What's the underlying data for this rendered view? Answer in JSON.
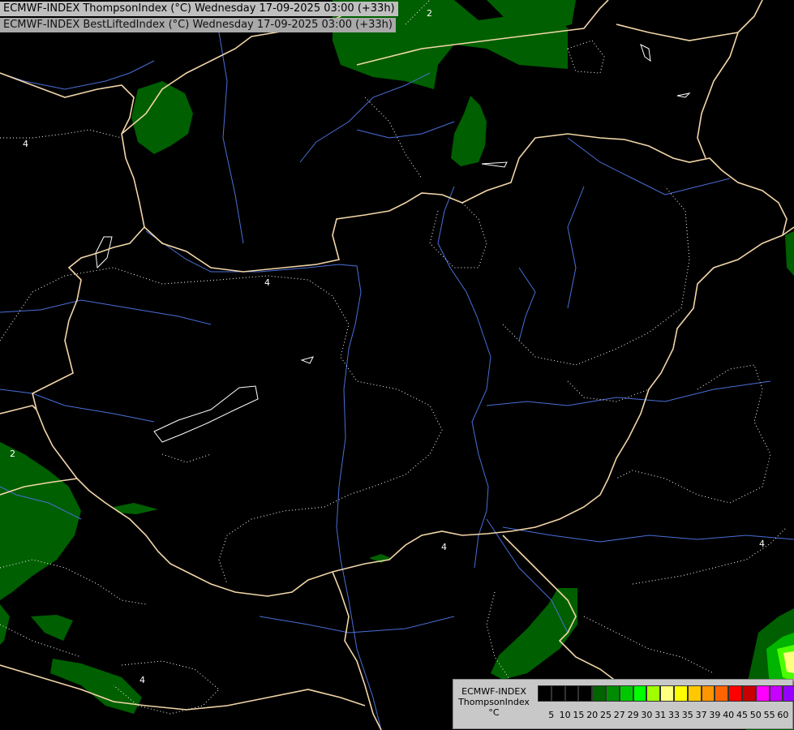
{
  "header": {
    "title_line1": "ECMWF-INDEX ThompsonIndex (°C) Wednesday 17-09-2025 03:00 (+33h)",
    "title_line2": "ECMWF-INDEX BestLiftedIndex (°C) Wednesday 17-09-2025 03:00 (+33h)"
  },
  "legend": {
    "line1": "ECMWF-INDEX",
    "line2": "ThompsonIndex",
    "unit": "°C",
    "colors": [
      "#000000",
      "#000000",
      "#000000",
      "#000000",
      "#006400",
      "#008c00",
      "#00c800",
      "#00ff00",
      "#a0ff00",
      "#ffff80",
      "#ffff00",
      "#ffc800",
      "#ff9600",
      "#ff6400",
      "#ff0000",
      "#c80000",
      "#ff00ff",
      "#c800ff",
      "#9600ff",
      "#6400ff",
      "#0000ff"
    ],
    "tick_labels": [
      "5",
      "10",
      "15",
      "20",
      "25",
      "27",
      "29",
      "30",
      "31",
      "33",
      "35",
      "37",
      "39",
      "40",
      "45",
      "50",
      "55",
      "60"
    ]
  },
  "contour_labels": [
    "2",
    "4",
    "4",
    "2",
    "4",
    "4",
    "4"
  ]
}
